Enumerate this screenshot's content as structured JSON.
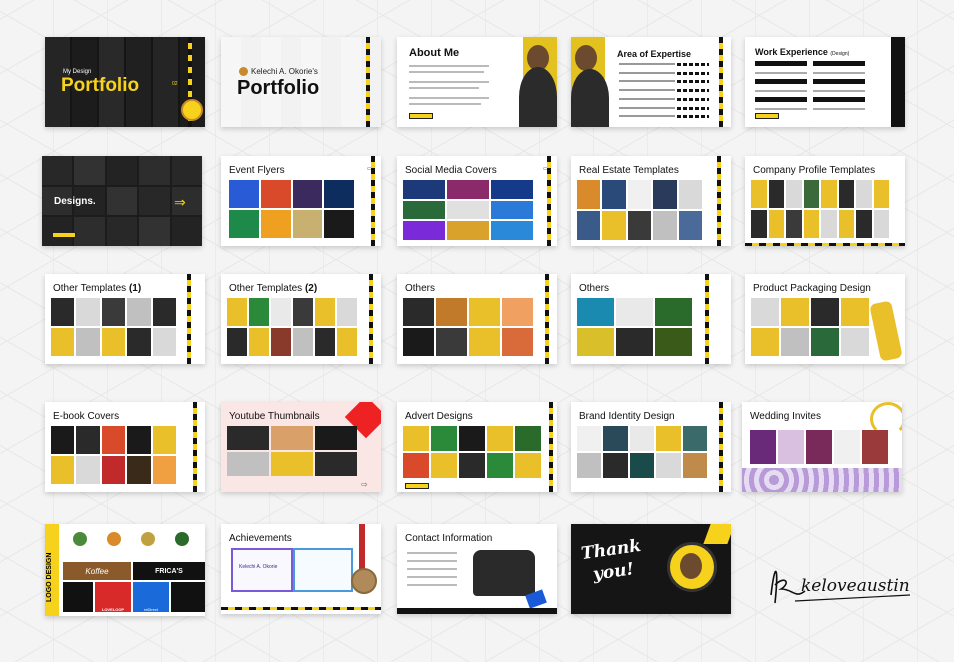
{
  "slides": {
    "cover": {
      "small": "My Design",
      "word": "Portfolio",
      "badge": "02"
    },
    "title": {
      "name": "Kelechi A. Okorie's",
      "word": "Portfolio"
    },
    "about": {
      "title": "About Me"
    },
    "expertise": {
      "title": "Area of Expertise"
    },
    "work": {
      "title": "Work Experience",
      "suffix": "(Design)"
    },
    "designs": {
      "title": "Designs."
    },
    "event": {
      "title": "Event Flyers"
    },
    "social": {
      "title": "Social Media Covers"
    },
    "realestate": {
      "title": "Real Estate Templates"
    },
    "company": {
      "title": "Company Profile Templates"
    },
    "other1": {
      "title": "Other Templates",
      "num": "(1)"
    },
    "other2": {
      "title": "Other Templates",
      "num": "(2)"
    },
    "others1": {
      "title": "Others"
    },
    "others2": {
      "title": "Others"
    },
    "packaging": {
      "title": "Product Packaging Design"
    },
    "ebook": {
      "title": "E-book Covers"
    },
    "youtube": {
      "title": "Youtube Thumbnails"
    },
    "advert": {
      "title": "Advert Designs"
    },
    "brand": {
      "title": "Brand Identity Design"
    },
    "wedding": {
      "title": "Wedding Invites"
    },
    "logo": {
      "vertical": "LOGO DESIGN",
      "brand1": "Koffee",
      "brand2": "FRICA'S",
      "brand3": "LOVELOOP",
      "brand4": "reDirect"
    },
    "achievements": {
      "title": "Achievements",
      "cert_name": "Kelechi A. Okorie"
    },
    "contact": {
      "title": "Contact Information"
    },
    "thanks": {
      "line1": "Thank",
      "line2": "you!"
    }
  },
  "signature": "keloveaustin",
  "colors": {
    "accent": "#f6d21c",
    "dark": "#1a1a1a"
  }
}
